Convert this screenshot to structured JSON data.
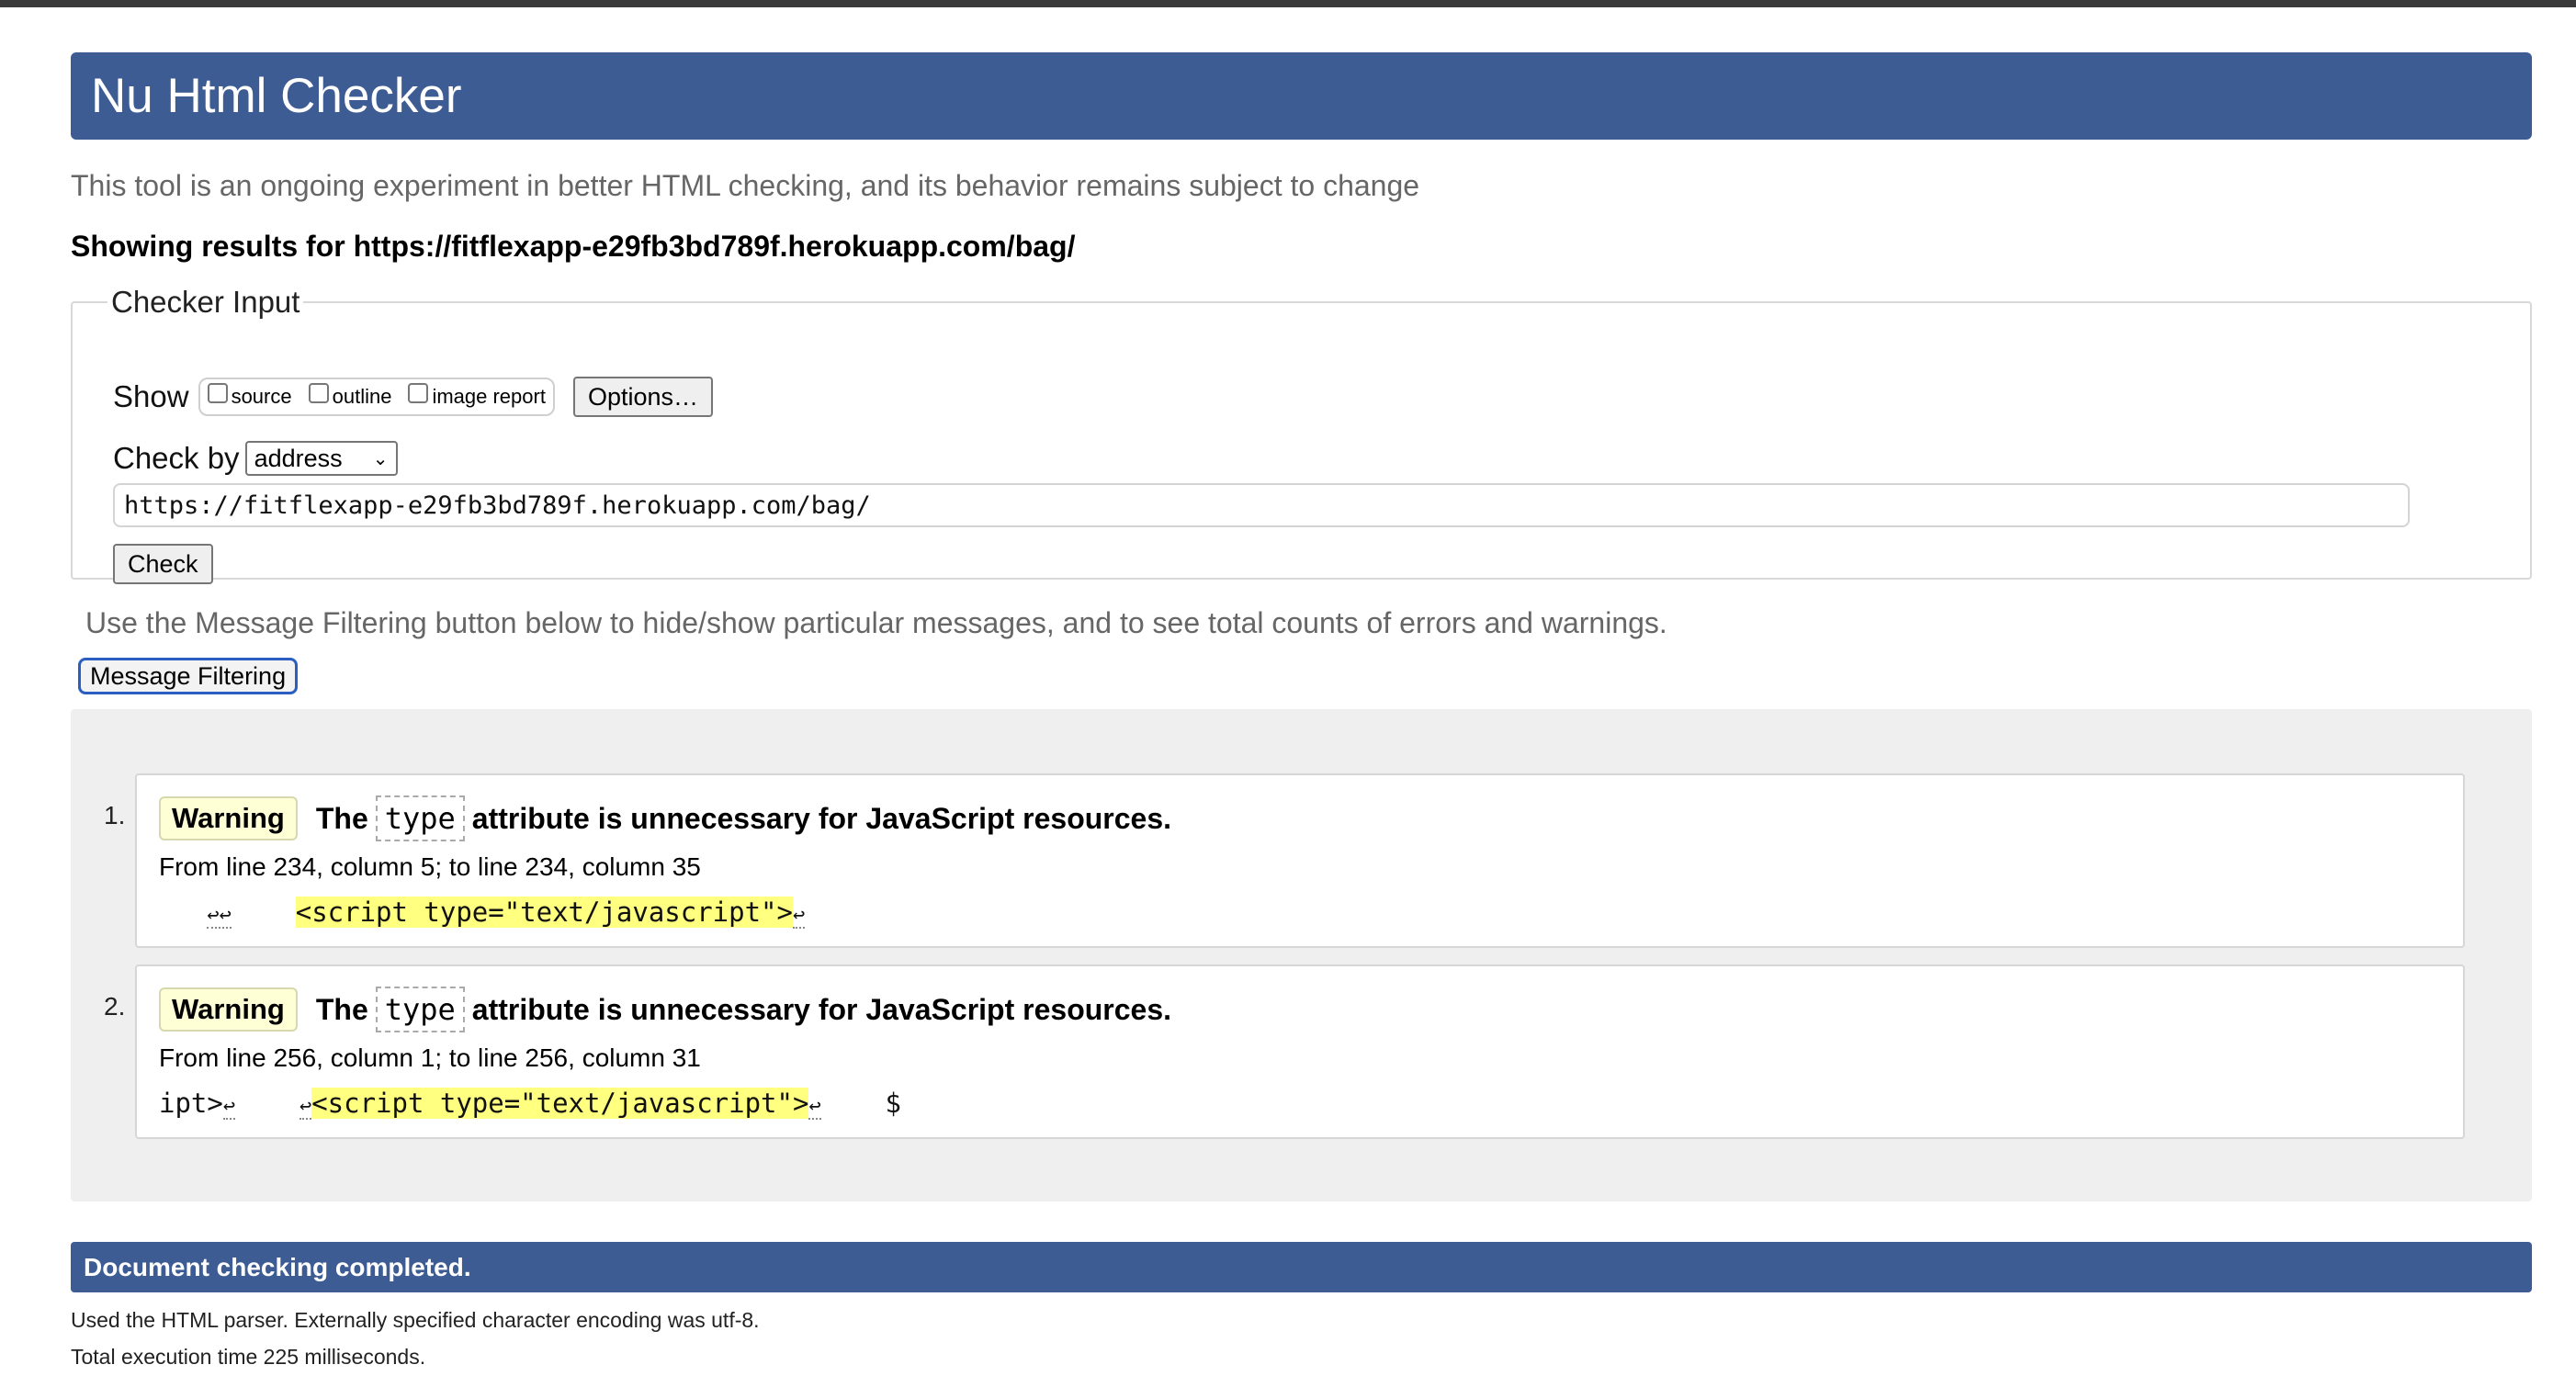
{
  "app": {
    "title": "Nu Html Checker",
    "intro": "This tool is an ongoing experiment in better HTML checking, and its behavior remains subject to change"
  },
  "results_for": {
    "prefix": "Showing results for ",
    "url": "https://fitflexapp-e29fb3bd789f.herokuapp.com/bag/"
  },
  "checker_input": {
    "legend": "Checker Input",
    "show_label": "Show",
    "show_options": [
      {
        "label": "source",
        "checked": false
      },
      {
        "label": "outline",
        "checked": false
      },
      {
        "label": "image report",
        "checked": false
      }
    ],
    "options_button": "Options…",
    "check_by_label": "Check by",
    "check_by_value": "address",
    "url_value": "https://fitflexapp-e29fb3bd789f.herokuapp.com/bag/",
    "check_button": "Check"
  },
  "filtering": {
    "info": "Use the Message Filtering button below to hide/show particular messages, and to see total counts of errors and warnings.",
    "button": "Message Filtering"
  },
  "messages": [
    {
      "number": "1.",
      "type": "Warning",
      "text_before": "The",
      "code": "type",
      "text_after": "attribute is unnecessary for JavaScript resources.",
      "location": "From line 234, column 5; to line 234, column 35",
      "extract_pre": "↩↩",
      "extract_gap": "    ",
      "extract_highlight": "<script type=\"text/javascript\">",
      "extract_post": "↩"
    },
    {
      "number": "2.",
      "type": "Warning",
      "text_before": "The",
      "code": "type",
      "text_after": "attribute is unnecessary for JavaScript resources.",
      "location": "From line 256, column 1; to line 256, column 31",
      "extract_pre": "ipt>",
      "extract_pre_lf": "↩",
      "extract_gap": "    ",
      "extract_lf2": "↩",
      "extract_highlight": "<script type=\"text/javascript\">",
      "extract_post": "↩",
      "extract_tail": "    $"
    }
  ],
  "footer": {
    "status": "Document checking completed.",
    "parser_info": "Used the HTML parser. Externally specified character encoding was utf-8.",
    "execution_time": "Total execution time 225 milliseconds."
  },
  "colors": {
    "header_blue": "#3e5c94",
    "warning_bg": "#ffffd6",
    "highlight": "#ffff80",
    "focus_ring": "#2a5fc1"
  }
}
